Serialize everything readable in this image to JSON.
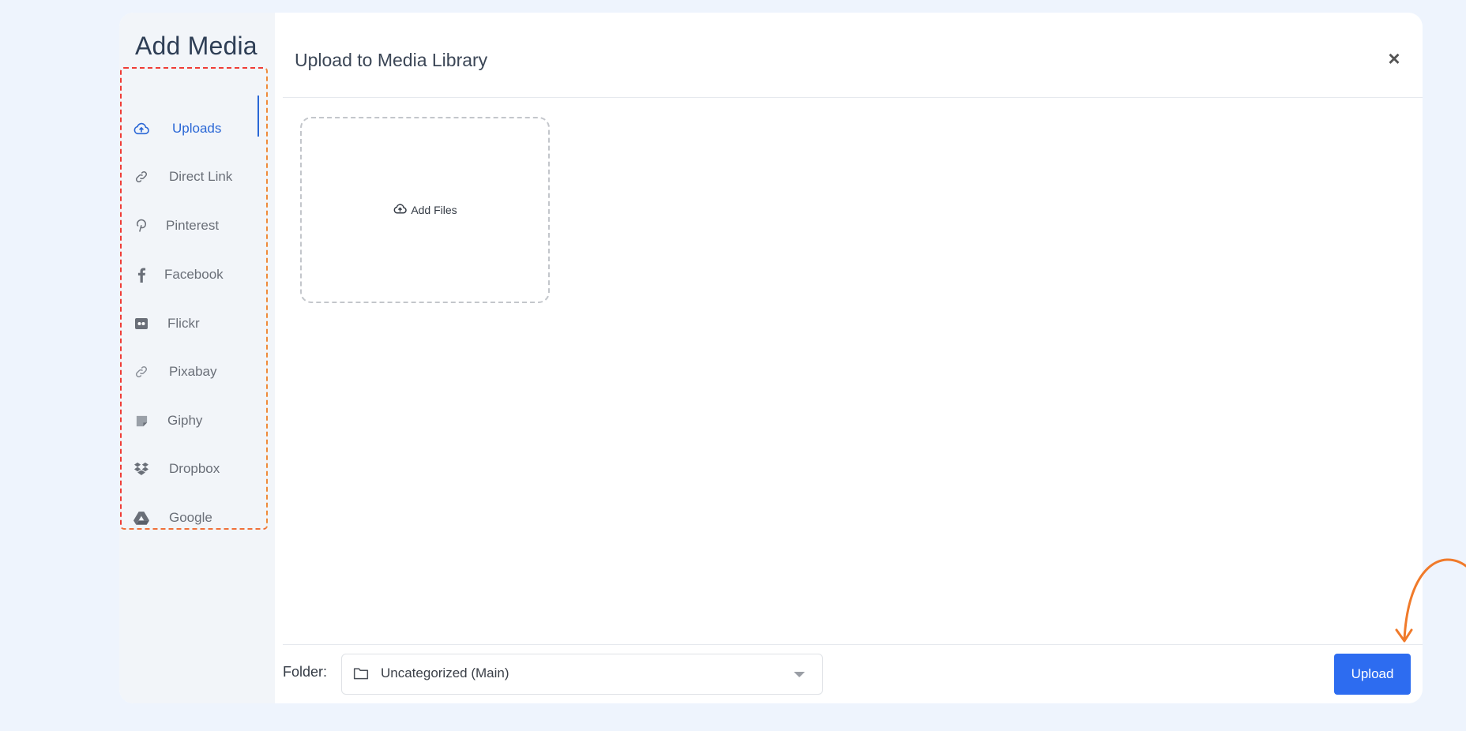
{
  "sidebar": {
    "title": "Add Media",
    "items": [
      {
        "label": "Uploads",
        "icon": "cloud-upload-icon",
        "active": true
      },
      {
        "label": "Direct Link",
        "icon": "link-icon"
      },
      {
        "label": "Pinterest",
        "icon": "pinterest-icon"
      },
      {
        "label": "Facebook",
        "icon": "facebook-icon"
      },
      {
        "label": "Flickr",
        "icon": "flickr-icon"
      },
      {
        "label": "Pixabay",
        "icon": "pixabay-icon"
      },
      {
        "label": "Giphy",
        "icon": "giphy-icon"
      },
      {
        "label": "Dropbox",
        "icon": "dropbox-icon"
      },
      {
        "label": "Google",
        "icon": "google-drive-icon"
      }
    ]
  },
  "main": {
    "title": "Upload to Media Library",
    "close_label": "×",
    "dropzone": {
      "label": "Add Files",
      "icon": "cloud-upload-icon"
    }
  },
  "footer": {
    "folder_label": "Folder:",
    "folder_value": "Uncategorized (Main)",
    "folder_icon": "folder-icon",
    "upload_label": "Upload"
  },
  "colors": {
    "accent": "#2d6cf0",
    "active_nav": "#2a67d6",
    "highlight_frame": "#ef3d37",
    "annotation_arrow": "#f07a2a",
    "page_background": "#eef4fd"
  }
}
